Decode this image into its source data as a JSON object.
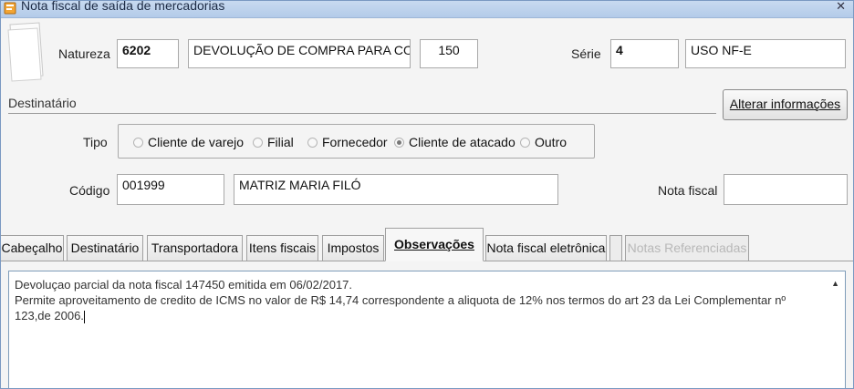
{
  "window": {
    "title": "Nota fiscal de saída de mercadorias",
    "close_glyph": "ꕝ"
  },
  "header": {
    "natureza_label": "Natureza",
    "natureza_code": "6202",
    "natureza_desc": "DEVOLUÇÃO DE COMPRA PARA COMER(",
    "natureza_num": "150",
    "serie_label": "Série",
    "serie_value": "4",
    "serie_desc": "USO NF-E"
  },
  "destinatario": {
    "section_title": "Destinatário",
    "alter_button": "Alterar informações",
    "tipo_label": "Tipo",
    "tipo_options": [
      {
        "label": "Cliente de varejo",
        "selected": false
      },
      {
        "label": "Filial",
        "selected": false
      },
      {
        "label": "Fornecedor",
        "selected": false
      },
      {
        "label": "Cliente de atacado",
        "selected": true
      },
      {
        "label": "Outro",
        "selected": false
      }
    ],
    "codigo_label": "Código",
    "codigo_value": "001999",
    "nome_value": "MATRIZ MARIA FILÓ",
    "nota_fiscal_label": "Nota fiscal",
    "nota_fiscal_value": ""
  },
  "tabs": [
    {
      "label": "Cabeçalho",
      "active": false,
      "disabled": false
    },
    {
      "label": "Destinatário",
      "active": false,
      "disabled": false
    },
    {
      "label": "Transportadora",
      "active": false,
      "disabled": false
    },
    {
      "label": "Itens fiscais",
      "active": false,
      "disabled": false
    },
    {
      "label": "Impostos",
      "active": false,
      "disabled": false
    },
    {
      "label": "Observações",
      "active": true,
      "disabled": false
    },
    {
      "label": "Nota fiscal eletrônica",
      "active": false,
      "disabled": false
    },
    {
      "label": "Notas Referenciadas",
      "active": false,
      "disabled": true
    }
  ],
  "observacoes": {
    "line1": "Devoluçao parcial da nota fiscal 147450 emitida em 06/02/2017.",
    "line2": "Permite aproveitamento de credito de ICMS no valor de R$ 14,74 correspondente a aliquota de 12% nos termos do art 23 da Lei Complementar nº 123,de 2006."
  },
  "icons": {
    "app": "document-icon",
    "scroll_up": "scroll-up-arrow-icon"
  }
}
